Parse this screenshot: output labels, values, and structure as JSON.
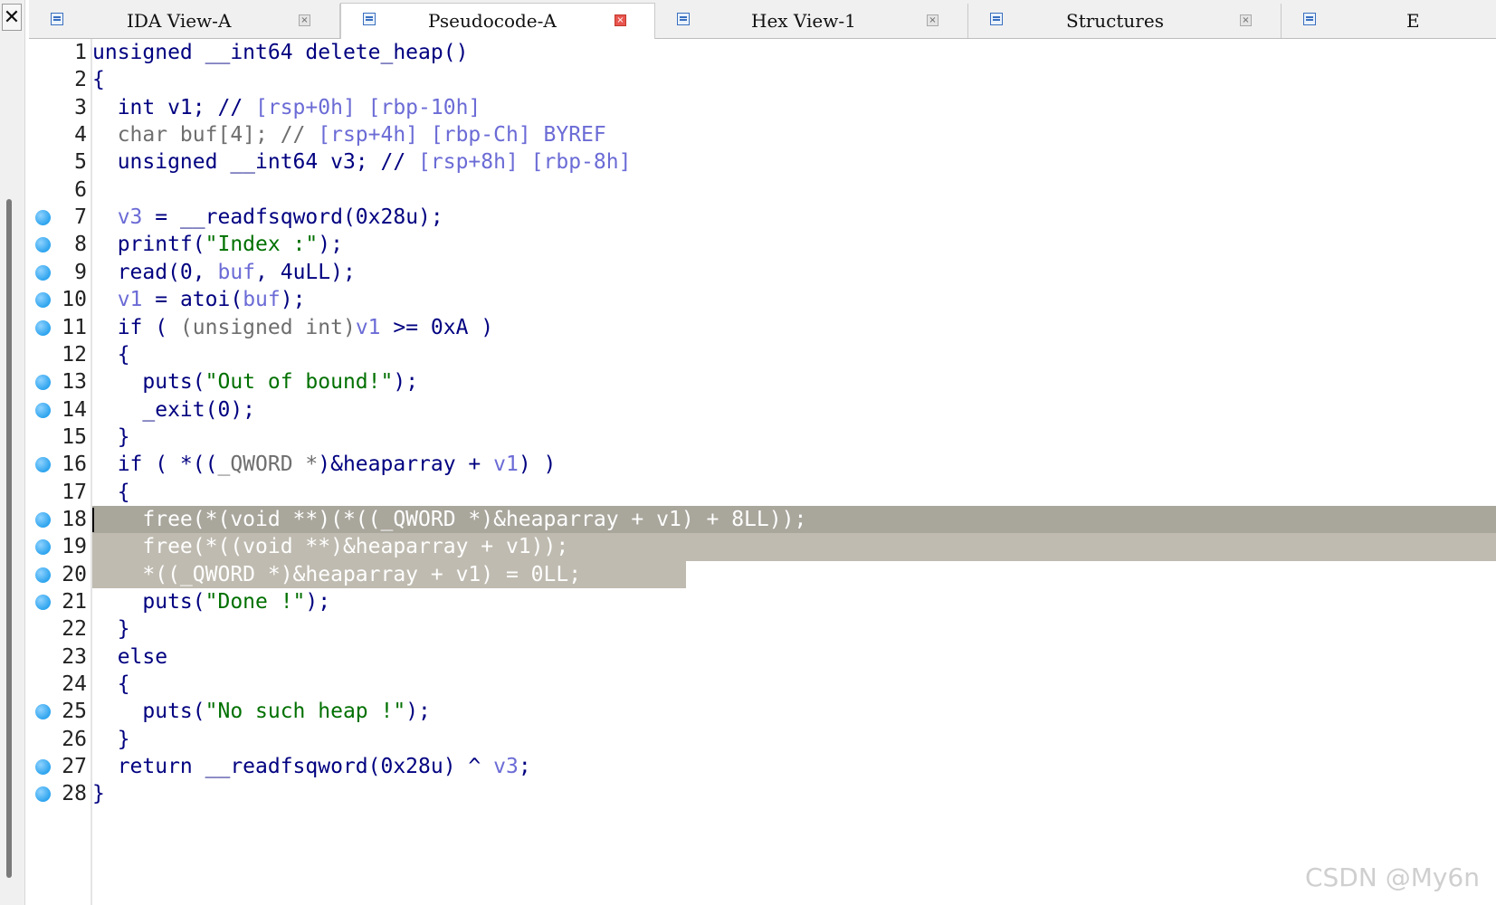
{
  "tabs": [
    {
      "label": "IDA View-A",
      "icon": "disasm-icon",
      "active": false
    },
    {
      "label": "Pseudocode-A",
      "icon": "pseudocode-icon",
      "active": true
    },
    {
      "label": "Hex View-1",
      "icon": "hex-icon",
      "active": false
    },
    {
      "label": "Structures",
      "icon": "struct-icon",
      "active": false
    },
    {
      "label": "E",
      "icon": "enum-icon",
      "active": false
    }
  ],
  "close_glyph": "✕",
  "tab_close_glyph": "×",
  "code": {
    "lines": [
      {
        "n": "1",
        "bp": false,
        "segs": [
          [
            "unsigned __int64 delete_heap()",
            "c-blue"
          ]
        ]
      },
      {
        "n": "2",
        "bp": false,
        "segs": [
          [
            "{",
            "c-blue"
          ]
        ]
      },
      {
        "n": "3",
        "bp": false,
        "segs": [
          [
            "  int v1; // ",
            "c-blue"
          ],
          [
            "[rsp+0h] [rbp-10h]",
            "c-var"
          ]
        ]
      },
      {
        "n": "4",
        "bp": false,
        "segs": [
          [
            "  char buf[4]; // ",
            "c-gray"
          ],
          [
            "[rsp+4h] [rbp-Ch] BYREF",
            "c-var"
          ]
        ]
      },
      {
        "n": "5",
        "bp": false,
        "segs": [
          [
            "  unsigned __int64 v3; // ",
            "c-blue"
          ],
          [
            "[rsp+8h] [rbp-8h]",
            "c-var"
          ]
        ]
      },
      {
        "n": "6",
        "bp": false,
        "segs": [
          [
            "",
            "c-blue"
          ]
        ]
      },
      {
        "n": "7",
        "bp": true,
        "segs": [
          [
            "  ",
            "c-blue"
          ],
          [
            "v3",
            "c-var"
          ],
          [
            " = __readfsqword(0x28u);",
            "c-blue"
          ]
        ]
      },
      {
        "n": "8",
        "bp": true,
        "segs": [
          [
            "  printf(",
            "c-blue"
          ],
          [
            "\"Index :\"",
            "c-str"
          ],
          [
            ");",
            "c-blue"
          ]
        ]
      },
      {
        "n": "9",
        "bp": true,
        "segs": [
          [
            "  read(0, ",
            "c-blue"
          ],
          [
            "buf",
            "c-var"
          ],
          [
            ", 4uLL);",
            "c-blue"
          ]
        ]
      },
      {
        "n": "10",
        "bp": true,
        "segs": [
          [
            "  ",
            "c-blue"
          ],
          [
            "v1",
            "c-var"
          ],
          [
            " = atoi(",
            "c-blue"
          ],
          [
            "buf",
            "c-var"
          ],
          [
            ");",
            "c-blue"
          ]
        ]
      },
      {
        "n": "11",
        "bp": true,
        "segs": [
          [
            "  if ( ",
            "c-blue"
          ],
          [
            "(unsigned int)",
            "c-gray"
          ],
          [
            "v1",
            "c-var"
          ],
          [
            " >= 0xA )",
            "c-blue"
          ]
        ]
      },
      {
        "n": "12",
        "bp": false,
        "segs": [
          [
            "  {",
            "c-blue"
          ]
        ]
      },
      {
        "n": "13",
        "bp": true,
        "segs": [
          [
            "    puts(",
            "c-blue"
          ],
          [
            "\"Out of bound!\"",
            "c-str"
          ],
          [
            ");",
            "c-blue"
          ]
        ]
      },
      {
        "n": "14",
        "bp": true,
        "segs": [
          [
            "    _exit(0);",
            "c-blue"
          ]
        ]
      },
      {
        "n": "15",
        "bp": false,
        "segs": [
          [
            "  }",
            "c-blue"
          ]
        ]
      },
      {
        "n": "16",
        "bp": true,
        "segs": [
          [
            "  if ( *((",
            "c-blue"
          ],
          [
            "_QWORD *",
            "c-gray"
          ],
          [
            ")&heaparray + ",
            "c-blue"
          ],
          [
            "v1",
            "c-var"
          ],
          [
            ") )",
            "c-blue"
          ]
        ]
      },
      {
        "n": "17",
        "bp": false,
        "segs": [
          [
            "  {",
            "c-blue"
          ]
        ]
      },
      {
        "n": "18",
        "bp": true,
        "hl": "dark",
        "segs": [
          [
            "    free(*(void **)(*((_QWORD *)&heaparray + v1) + 8LL));",
            "hl-text"
          ]
        ]
      },
      {
        "n": "19",
        "bp": true,
        "hl": "light",
        "segs": [
          [
            "    free(*((void **)&heaparray + v1));",
            "hl-text"
          ]
        ]
      },
      {
        "n": "20",
        "bp": true,
        "hl": "partial",
        "segs": [
          [
            "    *((_QWORD *)&heaparray + v1) = 0LL;",
            "hl-text"
          ]
        ]
      },
      {
        "n": "21",
        "bp": true,
        "segs": [
          [
            "    puts(",
            "c-blue"
          ],
          [
            "\"Done !\"",
            "c-str"
          ],
          [
            ");",
            "c-blue"
          ]
        ]
      },
      {
        "n": "22",
        "bp": false,
        "segs": [
          [
            "  }",
            "c-blue"
          ]
        ]
      },
      {
        "n": "23",
        "bp": false,
        "segs": [
          [
            "  else",
            "c-blue"
          ]
        ]
      },
      {
        "n": "24",
        "bp": false,
        "segs": [
          [
            "  {",
            "c-blue"
          ]
        ]
      },
      {
        "n": "25",
        "bp": true,
        "segs": [
          [
            "    puts(",
            "c-blue"
          ],
          [
            "\"No such heap !\"",
            "c-str"
          ],
          [
            ");",
            "c-blue"
          ]
        ]
      },
      {
        "n": "26",
        "bp": false,
        "segs": [
          [
            "  }",
            "c-blue"
          ]
        ]
      },
      {
        "n": "27",
        "bp": true,
        "segs": [
          [
            "  return __readfsqword(0x28u) ^ ",
            "c-blue"
          ],
          [
            "v3",
            "c-var"
          ],
          [
            ";",
            "c-blue"
          ]
        ]
      },
      {
        "n": "28",
        "bp": true,
        "segs": [
          [
            "}",
            "c-blue"
          ]
        ]
      }
    ]
  },
  "watermark": "CSDN @My6n",
  "colors": {
    "keyword": "#000080",
    "variable": "#6b6bd6",
    "string": "#007000",
    "selection": "#a9a69c",
    "breakpoint": "#2da4ee"
  }
}
